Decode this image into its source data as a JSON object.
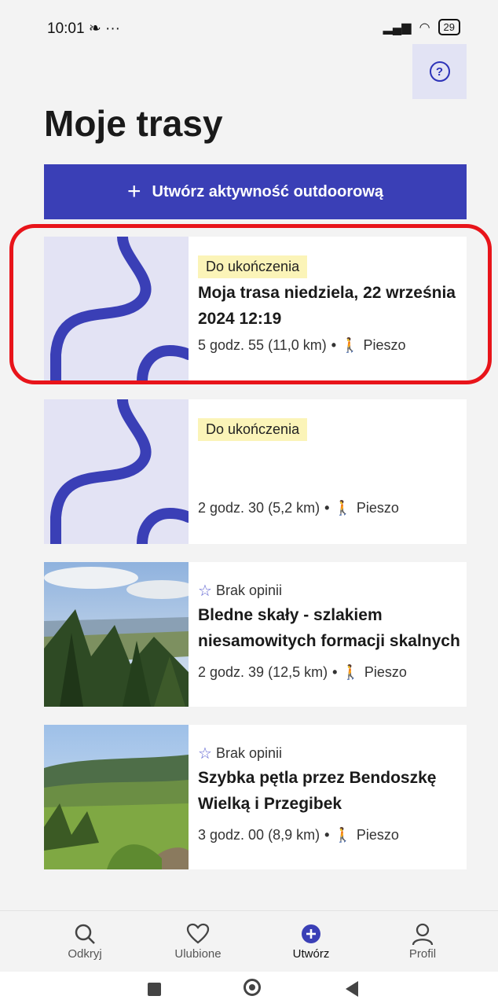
{
  "status_bar": {
    "time": "10:01",
    "extra": "···",
    "battery": "29"
  },
  "page": {
    "title": "Moje trasy",
    "create_button_label": "Utwórz aktywność outdoorową"
  },
  "routes": [
    {
      "badge": "Do ukończenia",
      "title": "Moja trasa niedziela, 22 września 2024 12:19",
      "duration": "5 godz. 55 (11,0 km)",
      "mode": "Pieszo",
      "thumbnail": "route-squiggle",
      "highlighted": true
    },
    {
      "badge": "Do ukończenia",
      "title": "",
      "duration": "2 godz. 30 (5,2 km)",
      "mode": "Pieszo",
      "thumbnail": "route-squiggle"
    },
    {
      "rating": "Brak opinii",
      "title": "Bledne skały - szlakiem niesamowitych formacji skalnych",
      "duration": "2 godz. 39 (12,5 km)",
      "mode": "Pieszo",
      "thumbnail": "forest-photo"
    },
    {
      "rating": "Brak opinii",
      "title": "Szybka pętla przez Bendoszkę Wielką i Przegibek",
      "duration": "3 godz. 00 (8,9 km)",
      "mode": "Pieszo",
      "thumbnail": "meadow-photo"
    }
  ],
  "bottom_nav": [
    {
      "label": "Odkryj",
      "icon": "search-icon"
    },
    {
      "label": "Ulubione",
      "icon": "heart-icon"
    },
    {
      "label": "Utwórz",
      "icon": "plus-circle-icon",
      "active": true
    },
    {
      "label": "Profil",
      "icon": "person-icon"
    }
  ],
  "colors": {
    "primary": "#3a3fb6",
    "badge": "#fbf4b8",
    "highlight": "#e8141a"
  }
}
